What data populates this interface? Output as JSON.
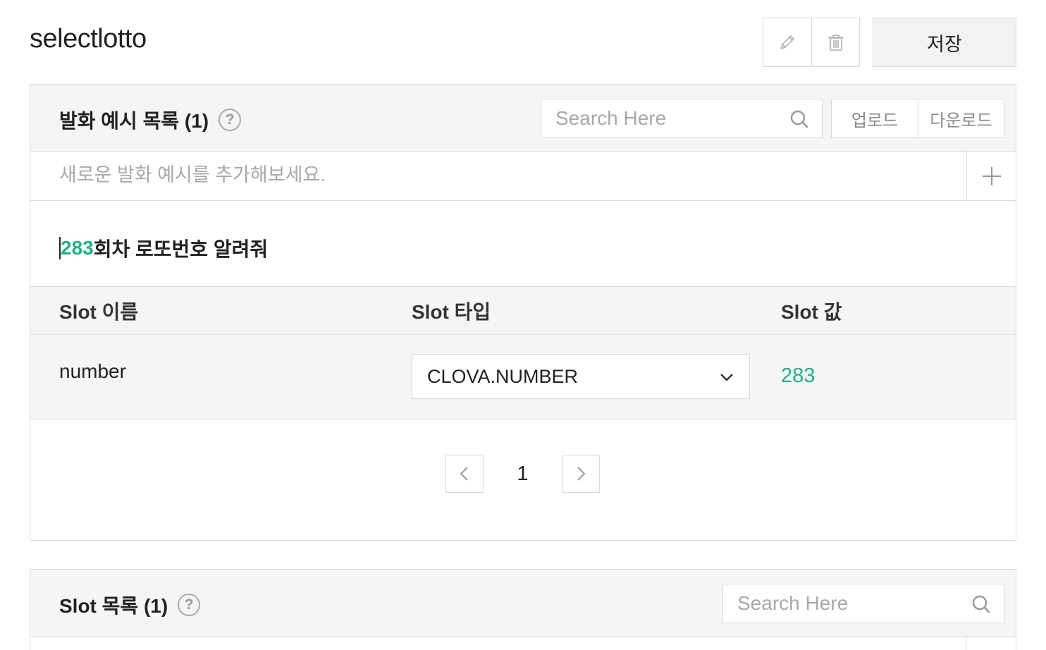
{
  "header": {
    "title": "selectlotto",
    "edit_icon": "pencil-icon",
    "delete_icon": "trash-icon",
    "save_label": "저장"
  },
  "utterances": {
    "title": "발화 예시 목록 (1)",
    "help": "?",
    "search_placeholder": "Search Here",
    "upload_label": "업로드",
    "download_label": "다운로드",
    "add_placeholder": "새로운 발화 예시를 추가해보세요.",
    "add_icon": "plus-icon",
    "example": {
      "highlight": "283",
      "rest": "회차 로또번호 알려줘"
    },
    "slot_table": {
      "headers": [
        "Slot 이름",
        "Slot 타입",
        "Slot 값"
      ],
      "rows": [
        {
          "name": "number",
          "type": "CLOVA.NUMBER",
          "value": "283"
        }
      ]
    },
    "pagination": {
      "current": "1"
    }
  },
  "slots": {
    "title": "Slot 목록 (1)",
    "help": "?",
    "search_placeholder": "Search Here"
  },
  "colors": {
    "accent": "#22b07d",
    "panel_bg": "#f5f5f5",
    "border": "#dcdcdc"
  }
}
